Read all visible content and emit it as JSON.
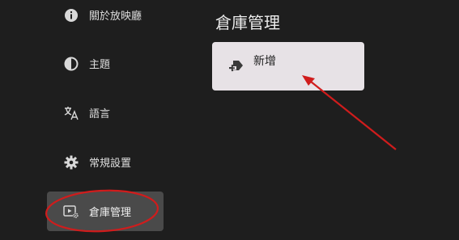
{
  "sidebar": {
    "items": [
      {
        "label": "關於放映廳",
        "icon": "info-icon",
        "selected": false
      },
      {
        "label": "主題",
        "icon": "contrast-icon",
        "selected": false
      },
      {
        "label": "語言",
        "icon": "translate-icon",
        "selected": false
      },
      {
        "label": "常規設置",
        "icon": "gear-icon",
        "selected": false
      },
      {
        "label": "倉庫管理",
        "icon": "repository-settings-icon",
        "selected": true
      }
    ]
  },
  "main": {
    "title": "倉庫管理",
    "add_card": {
      "label": "新增",
      "icon": "add-label-icon"
    }
  },
  "colors": {
    "background": "#1e1e1e",
    "selected_item": "#4a4a4a",
    "card": "#e7e2e6",
    "annotation_red": "#d01c1c"
  }
}
